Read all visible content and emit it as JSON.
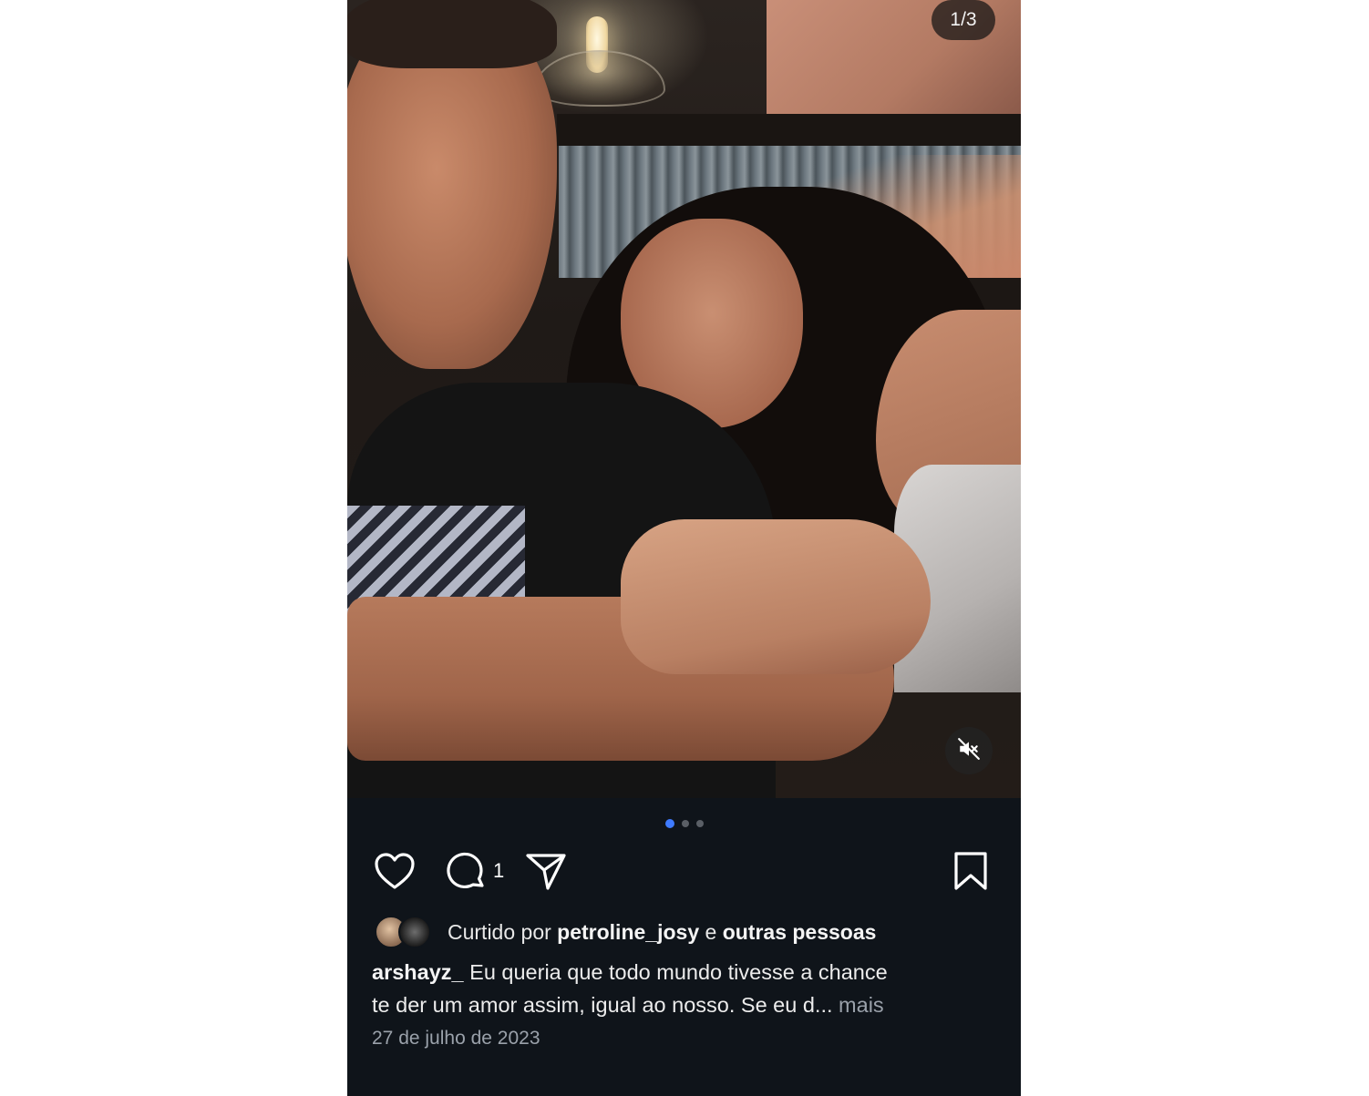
{
  "post": {
    "image_counter": "1/3",
    "carousel": {
      "total": 3,
      "active_index": 0
    },
    "actions": {
      "comment_count": "1"
    },
    "liked_by": {
      "prefix": "Curtido por",
      "user": "petroline_josy",
      "connector": "e",
      "others": "outras pessoas"
    },
    "caption": {
      "username": "arshayz_",
      "line1": "Eu queria que todo mundo tivesse a chance",
      "line2": "te der um amor assim, igual ao nosso. Se eu d...",
      "more": "mais"
    },
    "date": "27 de julho de 2023"
  },
  "colors": {
    "background": "#0f141a",
    "active_dot": "#3f7bff",
    "muted_text": "#9aa1aa"
  },
  "icons": [
    "heart-icon",
    "comment-icon",
    "share-icon",
    "bookmark-icon",
    "mute-icon"
  ]
}
